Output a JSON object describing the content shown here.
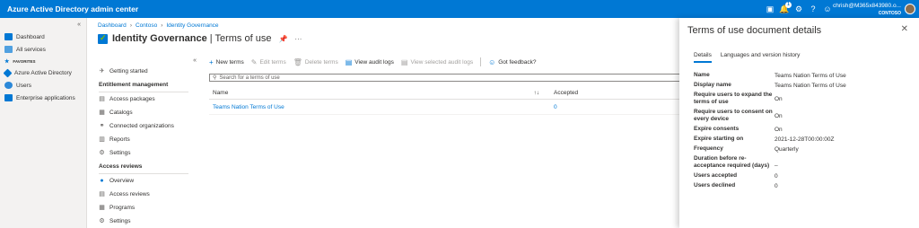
{
  "topbar": {
    "title": "Azure Active Directory admin center",
    "notification_count": "1",
    "account_email": "chrish@M365x843980.o...",
    "account_tenant": "CONTOSO"
  },
  "leftnav": {
    "items": [
      {
        "label": "Dashboard",
        "icon": "dashboard-icon",
        "color": "#0078d4"
      },
      {
        "label": "All services",
        "icon": "grid-icon",
        "color": "#0078d4"
      }
    ],
    "favorites_label": "FAVORITES",
    "favorites": [
      {
        "label": "Azure Active Directory",
        "icon": "aad-icon",
        "color": "#0078d4"
      },
      {
        "label": "Users",
        "icon": "users-icon",
        "color": "#0078d4"
      },
      {
        "label": "Enterprise applications",
        "icon": "apps-icon",
        "color": "#0078d4"
      }
    ]
  },
  "breadcrumb": [
    "Dashboard",
    "Contoso",
    "Identity Governance"
  ],
  "page": {
    "title": "Identity Governance",
    "subtitle": "| Terms of use"
  },
  "blade_nav": {
    "getting_started": "Getting started",
    "entitlement_header": "Entitlement management",
    "entitlement_items": [
      "Access packages",
      "Catalogs",
      "Connected organizations",
      "Reports",
      "Settings"
    ],
    "access_reviews_header": "Access reviews",
    "access_reviews_items": [
      "Overview",
      "Access reviews",
      "Programs",
      "Settings"
    ]
  },
  "toolbar": {
    "new_terms": "New terms",
    "edit_terms": "Edit terms",
    "delete_terms": "Delete terms",
    "view_audit_logs": "View audit logs",
    "view_selected_audit_logs": "View selected audit logs",
    "got_feedback": "Got feedback?"
  },
  "search": {
    "placeholder": "Search for a terms of use"
  },
  "grid": {
    "col_name": "Name",
    "col_accepted": "Accepted",
    "rows": [
      {
        "name": "Teams Nation Terms of Use",
        "accepted": "0"
      }
    ]
  },
  "panel": {
    "title": "Terms of use document details",
    "tabs": [
      "Details",
      "Languages and version history"
    ],
    "properties": [
      {
        "key": "Name",
        "value": "Teams Nation Terms of Use"
      },
      {
        "key": "Display name",
        "value": "Teams Nation Terms of Use"
      },
      {
        "key": "Require users to expand the terms of use",
        "value": "On"
      },
      {
        "key": "Require users to consent on every device",
        "value": "On"
      },
      {
        "key": "Expire consents",
        "value": "On"
      },
      {
        "key": "Expire starting on",
        "value": "2021-12-28T00:00:00Z"
      },
      {
        "key": "Frequency",
        "value": "Quarterly"
      },
      {
        "key": "Duration before re-acceptance required (days)",
        "value": "_"
      },
      {
        "key": "Users accepted",
        "value": "0"
      },
      {
        "key": "Users declined",
        "value": "0"
      }
    ]
  }
}
